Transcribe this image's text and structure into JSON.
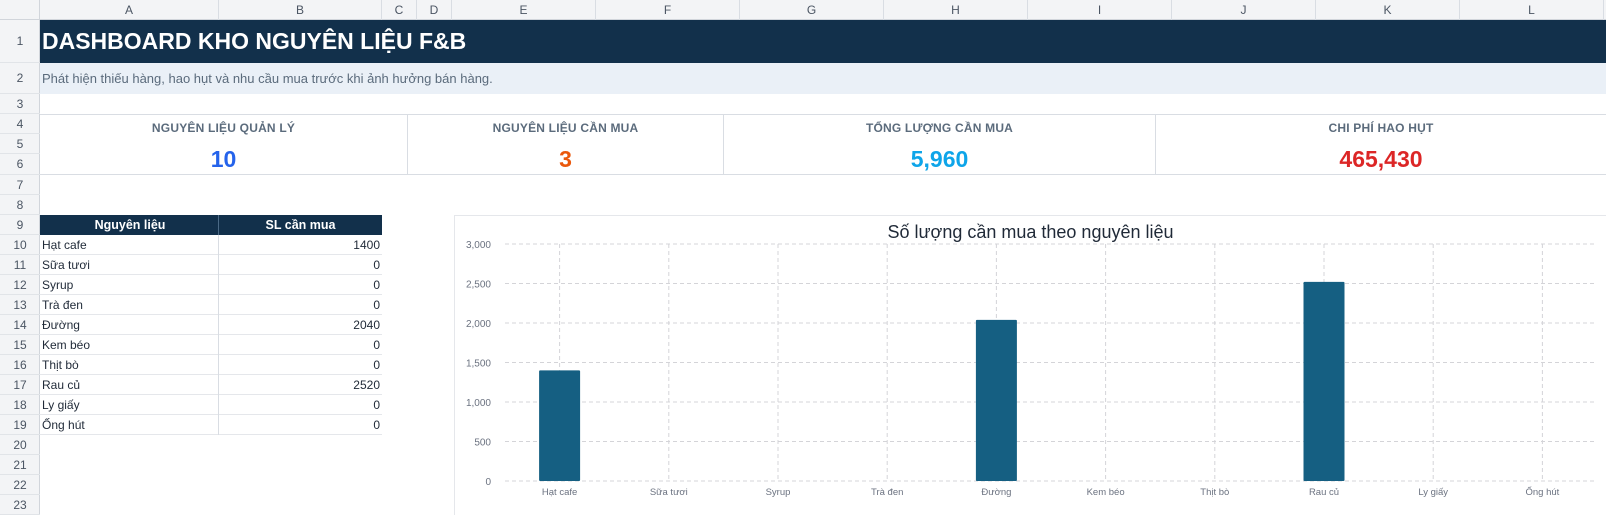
{
  "sheet": {
    "columns": [
      "A",
      "B",
      "C",
      "D",
      "E",
      "F",
      "G",
      "H",
      "I",
      "J",
      "K",
      "L"
    ],
    "rows": [
      "1",
      "2",
      "3",
      "4",
      "5",
      "6",
      "7",
      "8",
      "9",
      "10",
      "11",
      "12",
      "13",
      "14",
      "15",
      "16",
      "17",
      "18",
      "19",
      "20",
      "21",
      "22",
      "23"
    ]
  },
  "header": {
    "title": "DASHBOARD KHO NGUYÊN LIỆU F&B",
    "subtitle": "Phát hiện thiếu hàng, hao hụt và nhu cầu mua trước khi ảnh hưởng bán hàng."
  },
  "kpis": [
    {
      "label": "NGUYÊN LIỆU QUẢN LÝ",
      "value": "10",
      "color": "#2563eb"
    },
    {
      "label": "NGUYÊN LIỆU CẦN MUA",
      "value": "3",
      "color": "#ea580c"
    },
    {
      "label": "TỔNG LƯỢNG CẦN MUA",
      "value": "5,960",
      "color": "#0ea5e9"
    },
    {
      "label": "CHI PHÍ HAO HỤT",
      "value": "465,430",
      "color": "#dc2626"
    }
  ],
  "table": {
    "headers": [
      "Nguyên liệu",
      "SL cần mua"
    ],
    "rows": [
      {
        "name": "Hạt cafe",
        "qty": "1400"
      },
      {
        "name": "Sữa tươi",
        "qty": "0"
      },
      {
        "name": "Syrup",
        "qty": "0"
      },
      {
        "name": "Trà đen",
        "qty": "0"
      },
      {
        "name": "Đường",
        "qty": "2040"
      },
      {
        "name": "Kem béo",
        "qty": "0"
      },
      {
        "name": "Thịt bò",
        "qty": "0"
      },
      {
        "name": "Rau củ",
        "qty": "2520"
      },
      {
        "name": "Ly giấy",
        "qty": "0"
      },
      {
        "name": "Ống hút",
        "qty": "0"
      }
    ]
  },
  "chart_data": {
    "type": "bar",
    "title": "Số lượng cần mua theo nguyên liệu",
    "categories": [
      "Hạt cafe",
      "Sữa tươi",
      "Syrup",
      "Trà đen",
      "Đường",
      "Kem béo",
      "Thịt bò",
      "Rau củ",
      "Ly giấy",
      "Ống hút"
    ],
    "values": [
      1400,
      0,
      0,
      0,
      2040,
      0,
      0,
      2520,
      0,
      0
    ],
    "ylim": [
      0,
      3000
    ],
    "yticks": [
      "0",
      "500",
      "1,000",
      "1,500",
      "2,000",
      "2,500",
      "3,000"
    ],
    "grid": true,
    "legend": "none",
    "bar_color": "#155f82"
  }
}
